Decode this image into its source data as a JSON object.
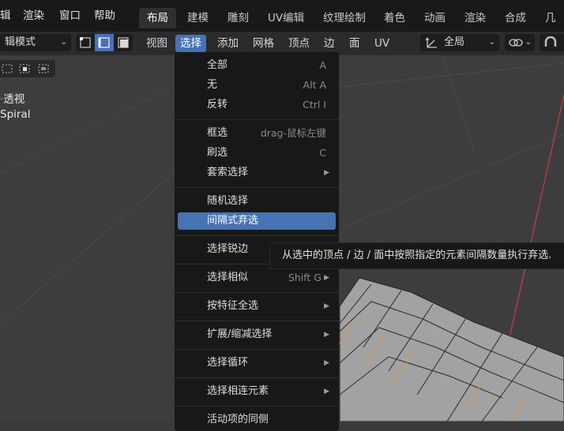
{
  "topmenu": {
    "items": [
      "辑",
      "渲染",
      "窗口",
      "帮助"
    ]
  },
  "workspace_tabs": [
    "布局",
    "建模",
    "雕刻",
    "UV编辑",
    "纹理绘制",
    "着色",
    "动画",
    "渲染",
    "合成",
    "几何"
  ],
  "header": {
    "mode": "辑模式",
    "menus": [
      "视图",
      "选择",
      "添加",
      "网格",
      "顶点",
      "边",
      "面",
      "UV"
    ],
    "orientation": "全局"
  },
  "overlay": {
    "view_name": "透视",
    "object_name": "Spiral"
  },
  "select_menu": {
    "items": [
      {
        "label": "全部",
        "shortcut": "A"
      },
      {
        "label": "无",
        "shortcut": "Alt A"
      },
      {
        "label": "反转",
        "shortcut": "Ctrl I"
      },
      {
        "label": "框选",
        "shortcut": "drag-鼠标左键"
      },
      {
        "label": "刷选",
        "shortcut": "C"
      },
      {
        "label": "套索选择",
        "shortcut": ""
      },
      {
        "label": "随机选择",
        "shortcut": ""
      },
      {
        "label": "间隔式弃选",
        "shortcut": ""
      },
      {
        "label": "选择锐边",
        "shortcut": ""
      },
      {
        "label": "选择相似",
        "shortcut": "Shift G"
      },
      {
        "label": "按特征全选",
        "shortcut": ""
      },
      {
        "label": "扩展/缩减选择",
        "shortcut": ""
      },
      {
        "label": "选择循环",
        "shortcut": ""
      },
      {
        "label": "选择相连元素",
        "shortcut": ""
      },
      {
        "label": "活动项的同侧",
        "shortcut": ""
      }
    ]
  },
  "tooltip": {
    "text": "从选中的顶点 / 边 / 面中按照指定的元素间隔数量执行弃选."
  },
  "colors": {
    "accent": "#4772b3",
    "menu_bg": "#181818",
    "viewport_bg": "#3d3d3d",
    "mesh_face": "#a2a2a2",
    "seam": "#e08f3a",
    "axis_x": "#c23b47"
  }
}
